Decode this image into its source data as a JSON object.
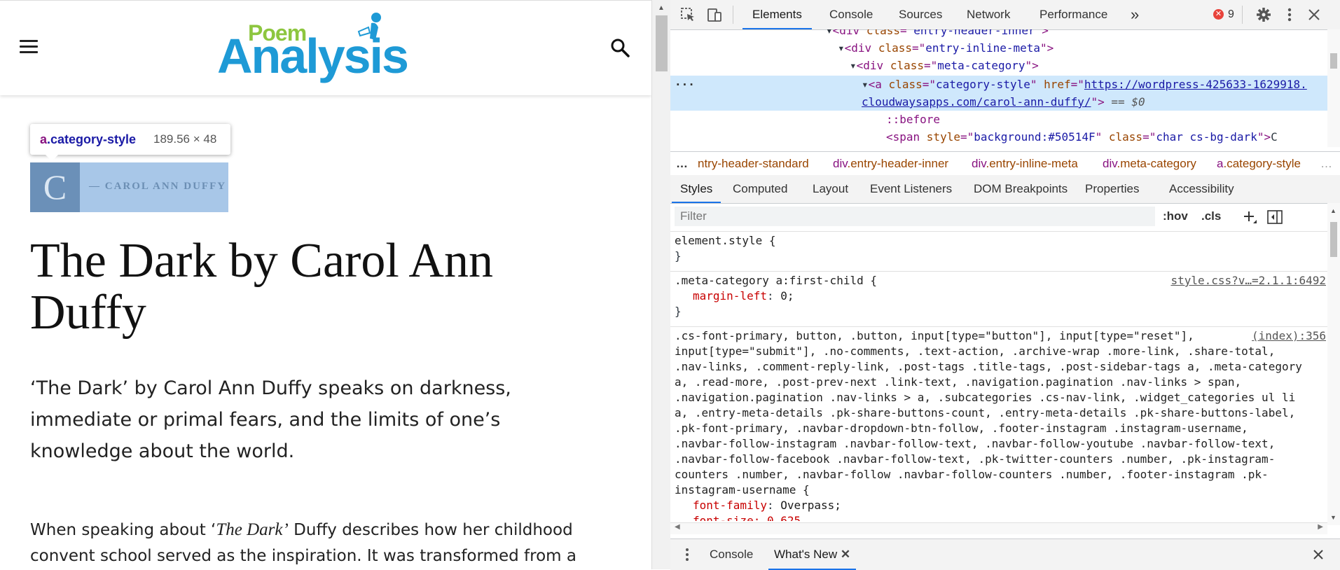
{
  "site": {
    "logo_top": "Poem",
    "logo_main": "Analysis"
  },
  "inspect_tooltip": {
    "tag": "a",
    "class": ".category-style",
    "dimensions": "189.56 × 48"
  },
  "category": {
    "letter": "C",
    "label": "— CAROL ANN DUFFY"
  },
  "article": {
    "title": "The Dark by Carol Ann Duffy",
    "lead": "‘The Dark’ by Carol Ann Duffy speaks on darkness, immediate or primal fears, and the limits of one’s knowledge about the world.",
    "body_pre": "When speaking about ‘",
    "body_italic": "The Dark’",
    "body_post": " Duffy describes how her childhood convent school served as the inspiration. It was transformed from a “girls’"
  },
  "devtools": {
    "tabs": [
      "Elements",
      "Console",
      "Sources",
      "Network",
      "Performance"
    ],
    "more_tabs": "»",
    "error_count": "9",
    "dom": {
      "line1": {
        "tag_open": "<div ",
        "attr": "class",
        "eq": "=\"",
        "val": "entry-header-inner",
        "close": "\">"
      },
      "line2": {
        "tag_open": "<div ",
        "attr": "class",
        "eq": "=\"",
        "val": "entry-inline-meta",
        "close": "\">"
      },
      "line3": {
        "tag_open": "<div ",
        "attr": "class",
        "eq": "=\"",
        "val": "meta-category",
        "close": "\">"
      },
      "line4": {
        "tag_open": "<a ",
        "attr": "class",
        "eq": "=\"",
        "val": "category-style",
        "q": "\" ",
        "attr2": "href",
        "eq2": "=\"",
        "href1": "https://wordpress-425633-1629918.",
        "href2": "cloudwaysapps.com/carol-ann-duffy/",
        "close": "\">",
        "suffix": " == $0"
      },
      "line5": "::before",
      "line6": {
        "tag_open": "<span ",
        "attr": "style",
        "eq": "=\"",
        "val": "background:#50514F",
        "q": "\" ",
        "attr2": "class",
        "eq2": "=\"",
        "val2": "char cs-bg-dark",
        "close": "\">",
        "text": "C"
      }
    },
    "breadcrumbs": [
      {
        "tag": "",
        "cls": "ntry-header-standard"
      },
      {
        "tag": "div",
        "cls": ".entry-header-inner"
      },
      {
        "tag": "div",
        "cls": ".entry-inline-meta"
      },
      {
        "tag": "div",
        "cls": ".meta-category"
      },
      {
        "tag": "a",
        "cls": ".category-style"
      }
    ],
    "sub_tabs": [
      "Styles",
      "Computed",
      "Layout",
      "Event Listeners",
      "DOM Breakpoints",
      "Properties",
      "Accessibility"
    ],
    "filter_placeholder": "Filter",
    "filter_hov": ":hov",
    "filter_cls": ".cls",
    "styles": {
      "rule1_selector": "element.style {",
      "rule1_close": "}",
      "rule2_selector": ".meta-category a:first-child {",
      "rule2_source": "style.css?v…=2.1.1:6492",
      "rule2_prop": "margin-left",
      "rule2_val": "0;",
      "rule2_close": "}",
      "rule3_source": "(index):356",
      "rule3_lines": [
        ".cs-font-primary, button, .button, input[type=\"button\"], input[type=\"reset\"],",
        "input[type=\"submit\"], .no-comments, .text-action, .archive-wrap .more-link, .share-total,",
        ".nav-links, .comment-reply-link, .post-tags .title-tags, .post-sidebar-tags a, .meta-category",
        "a, .read-more, .post-prev-next .link-text, .navigation.pagination .nav-links > span,",
        ".navigation.pagination .nav-links > a, .subcategories .cs-nav-link, .widget_categories ul li",
        "a, .entry-meta-details .pk-share-buttons-count, .entry-meta-details .pk-share-buttons-label,",
        ".pk-font-primary, .navbar-dropdown-btn-follow, .footer-instagram .instagram-username,",
        ".navbar-follow-instagram .navbar-follow-text, .navbar-follow-youtube .navbar-follow-text,",
        ".navbar-follow-facebook .navbar-follow-text, .pk-twitter-counters .number, .pk-instagram-",
        "counters .number, .navbar-follow .navbar-follow-counters .number, .footer-instagram .pk-",
        "instagram-username {"
      ],
      "rule3_prop": "font-family",
      "rule3_val": "Overpass;",
      "rule3_partial": "font-size: 0.625"
    },
    "drawer_tabs": [
      "Console",
      "What's New"
    ]
  },
  "colors": {
    "accent": "#1a73e8",
    "selected_row": "#cfe8fc",
    "tag": "#881280",
    "attr": "#994500",
    "value": "#1a1aa6",
    "logo_blue": "#1e9ad6",
    "logo_green": "#8dc63f",
    "error": "#e8433b"
  }
}
